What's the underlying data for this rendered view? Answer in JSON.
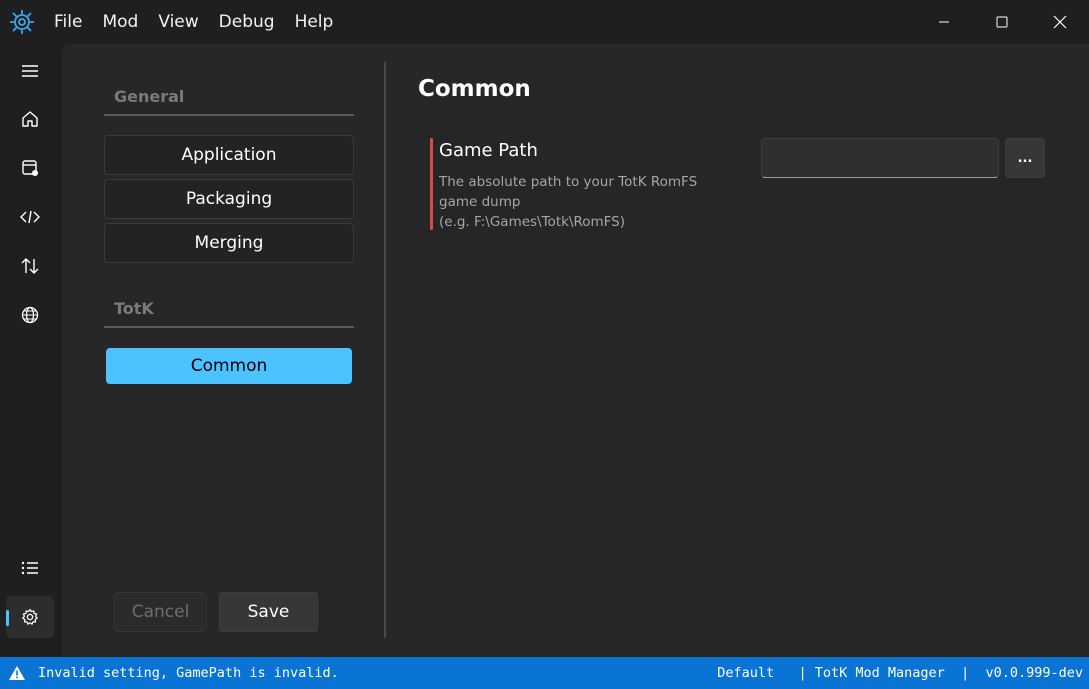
{
  "menu": {
    "items": [
      {
        "label": "File"
      },
      {
        "label": "Mod"
      },
      {
        "label": "View"
      },
      {
        "label": "Debug"
      },
      {
        "label": "Help"
      }
    ]
  },
  "rail": {
    "icons": [
      "hamburger-icon",
      "home-icon",
      "mods-icon",
      "code-icon",
      "sort-icon",
      "globe-icon",
      "list-icon",
      "settings-icon"
    ],
    "active": "settings-icon"
  },
  "nav": {
    "groups": [
      {
        "header": "General",
        "items": [
          "Application",
          "Packaging",
          "Merging"
        ]
      },
      {
        "header": "TotK",
        "items": [
          "Common"
        ]
      }
    ],
    "selected": "Common",
    "cancel_label": "Cancel",
    "save_label": "Save"
  },
  "page": {
    "title": "Common",
    "setting": {
      "name": "Game Path",
      "description_lines": [
        "The absolute path to your TotK RomFS",
        "game dump",
        "(e.g. F:\\Games\\Totk\\RomFS)"
      ],
      "value": "",
      "browse_label": "..."
    }
  },
  "status": {
    "message": "Invalid setting, GamePath is invalid.",
    "theme": "Default",
    "app_name": "TotK Mod Manager",
    "version": "v0.0.999-dev"
  },
  "colors": {
    "accent": "#4cc2ff",
    "status_bar": "#0a74d4",
    "error": "#e04848"
  }
}
